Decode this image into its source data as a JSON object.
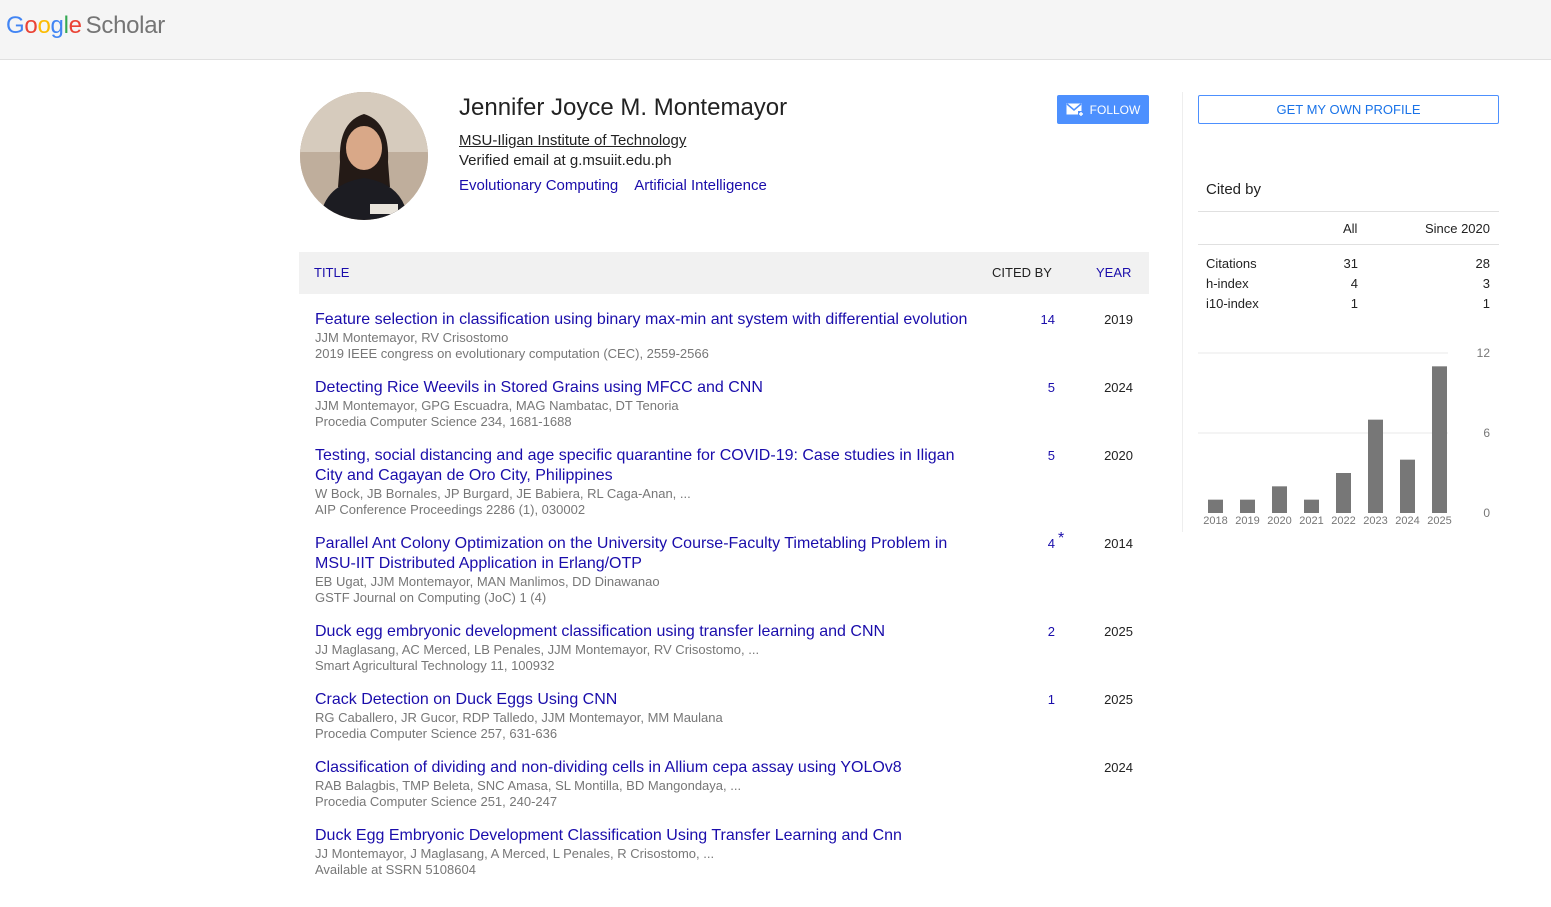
{
  "brand": {
    "scholar": "Scholar"
  },
  "profile": {
    "name": "Jennifer Joyce M. Montemayor",
    "affiliation": "MSU-Iligan Institute of Technology",
    "email": "Verified email at g.msuiit.edu.ph",
    "interests": [
      "Evolutionary Computing",
      "Artificial Intelligence"
    ],
    "follow_label": "FOLLOW"
  },
  "table": {
    "col_title": "TITLE",
    "col_cited": "CITED BY",
    "col_year": "YEAR"
  },
  "articles": [
    {
      "title_l1": "Feature selection in classification using binary max-min ant system with differential evolution",
      "title_l2": "",
      "authors": "JJM Montemayor, RV Crisostomo",
      "venue": "2019 IEEE congress on evolutionary computation (CEC), 2559-2566",
      "cited": "14",
      "star": "",
      "year": "2019"
    },
    {
      "title_l1": "Detecting Rice Weevils in Stored Grains using MFCC and CNN",
      "title_l2": "",
      "authors": "JJM Montemayor, GPG Escuadra, MAG Nambatac, DT Tenoria",
      "venue": "Procedia Computer Science 234, 1681-1688",
      "cited": "5",
      "star": "",
      "year": "2024"
    },
    {
      "title_l1": "Testing, social distancing and age specific quarantine for COVID-19: Case studies in Iligan",
      "title_l2": "City and Cagayan de Oro City, Philippines",
      "authors": "W Bock, JB Bornales, JP Burgard, JE Babiera, RL Caga-Anan, ...",
      "venue": "AIP Conference Proceedings 2286 (1), 030002",
      "cited": "5",
      "star": "",
      "year": "2020"
    },
    {
      "title_l1": "Parallel Ant Colony Optimization on the University Course-Faculty Timetabling Problem in",
      "title_l2": "MSU-IIT Distributed Application in Erlang/OTP",
      "authors": "EB Ugat, JJM Montemayor, MAN Manlimos, DD Dinawanao",
      "venue": "GSTF Journal on Computing (JoC) 1 (4)",
      "cited": "4",
      "star": "*",
      "year": "2014"
    },
    {
      "title_l1": "Duck egg embryonic development classification using transfer learning and CNN",
      "title_l2": "",
      "authors": "JJ Maglasang, AC Merced, LB Penales, JJM Montemayor, RV Crisostomo, ...",
      "venue": "Smart Agricultural Technology 11, 100932",
      "cited": "2",
      "star": "",
      "year": "2025"
    },
    {
      "title_l1": "Crack Detection on Duck Eggs Using CNN",
      "title_l2": "",
      "authors": "RG Caballero, JR Gucor, RDP Talledo, JJM Montemayor, MM Maulana",
      "venue": "Procedia Computer Science 257, 631-636",
      "cited": "1",
      "star": "",
      "year": "2025"
    },
    {
      "title_l1": "Classification of dividing and non-dividing cells in Allium cepa assay using YOLOv8",
      "title_l2": "",
      "authors": "RAB Balagbis, TMP Beleta, SNC Amasa, SL Montilla, BD Mangondaya, ...",
      "venue": "Procedia Computer Science 251, 240-247",
      "cited": "",
      "star": "",
      "year": "2024"
    },
    {
      "title_l1": "Duck Egg Embryonic Development Classification Using Transfer Learning and Cnn",
      "title_l2": "",
      "authors": "JJ Montemayor, J Maglasang, A Merced, L Penales, R Crisostomo, ...",
      "venue": "Available at SSRN 5108604",
      "cited": "",
      "star": "",
      "year": ""
    }
  ],
  "sidebar": {
    "own_profile_label": "GET MY OWN PROFILE",
    "cited_by_title": "Cited by",
    "col_all": "All",
    "col_since": "Since 2020",
    "metrics": [
      {
        "label": "Citations",
        "all": "31",
        "since": "28"
      },
      {
        "label": "h-index",
        "all": "4",
        "since": "3"
      },
      {
        "label": "i10-index",
        "all": "1",
        "since": "1"
      }
    ]
  },
  "chart_data": {
    "type": "bar",
    "categories": [
      "2018",
      "2019",
      "2020",
      "2021",
      "2022",
      "2023",
      "2024",
      "2025"
    ],
    "values": [
      1,
      1,
      2,
      1,
      3,
      7,
      4,
      11
    ],
    "yticks": [
      "12",
      "6",
      "0"
    ],
    "ylim": [
      0,
      12
    ],
    "bar_color": "#777777"
  }
}
